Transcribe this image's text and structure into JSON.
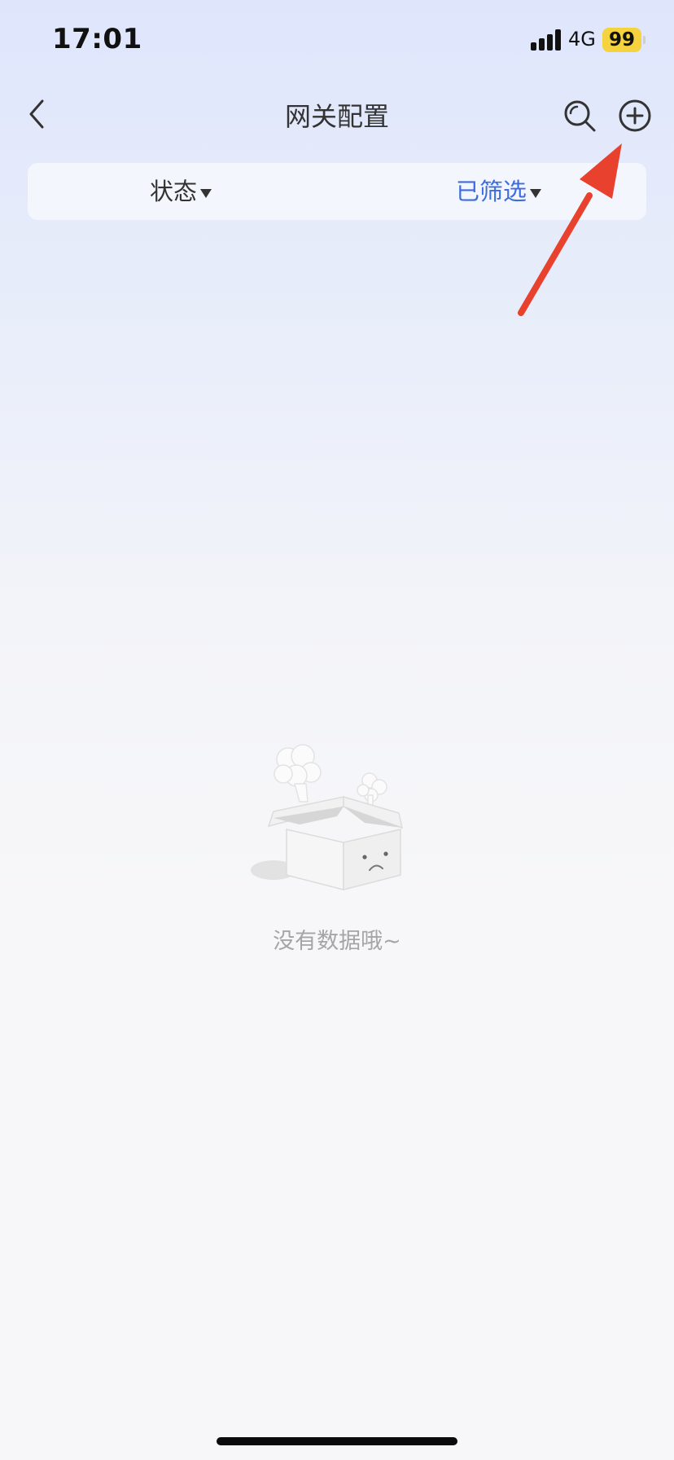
{
  "status_bar": {
    "time": "17:01",
    "network": "4G",
    "battery": "99",
    "icons": [
      "cellular-signal-icon",
      "battery-icon"
    ]
  },
  "nav": {
    "title": "网关配置",
    "icons": [
      "chevron-left-icon",
      "search-icon",
      "plus-circle-icon"
    ]
  },
  "filters": {
    "status_label": "状态",
    "filtered_label": "已筛选",
    "colors": {
      "active": "#3d6ce0",
      "default": "#333333"
    }
  },
  "empty_state": {
    "message": "没有数据哦~",
    "icon": "empty-box-icon"
  },
  "annotation": {
    "icon": "red-arrow-icon",
    "color": "#e8412e"
  }
}
